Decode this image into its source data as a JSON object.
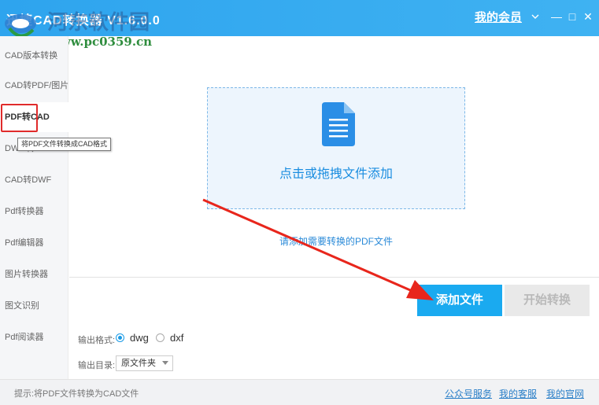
{
  "app": {
    "title": "迅捷CAD转换器 V1.6.0.0",
    "member_link": "我的会员",
    "watermark": "河东软件园",
    "watermark_url": "www.pc0359.cn"
  },
  "window_controls": {
    "dropdown_icon": "chevron-down-icon",
    "minimize": "—",
    "maximize": "□",
    "close": "✕"
  },
  "sidebar": {
    "items": [
      {
        "label": "CAD版本转换"
      },
      {
        "label": "CAD转PDF/图片"
      },
      {
        "label": "PDF转CAD",
        "active": true
      },
      {
        "label": "DWG转DWF"
      },
      {
        "label": "CAD转DWF"
      },
      {
        "label": "Pdf转换器"
      },
      {
        "label": "Pdf编辑器"
      },
      {
        "label": "图片转换器"
      },
      {
        "label": "图文识别"
      },
      {
        "label": "Pdf阅读器"
      }
    ],
    "tooltip": "将PDF文件转换成CAD格式"
  },
  "main": {
    "dropzone_icon": "document-icon",
    "dropzone_text": "点击或拖拽文件添加",
    "hint": "请添加需要转换的PDF文件",
    "add_button": "添加文件",
    "start_button": "开始转换"
  },
  "options": {
    "format_label": "输出格式:",
    "formats": [
      {
        "label": "dwg",
        "checked": true
      },
      {
        "label": "dxf",
        "checked": false
      }
    ],
    "dir_label": "输出目录:",
    "dir_value": "原文件夹"
  },
  "statusbar": {
    "text": "提示:将PDF文件转换为CAD文件",
    "links": [
      "公众号服务",
      "我的客服",
      "我的官网"
    ]
  },
  "colors": {
    "titlebar": "#2ea4ee",
    "accent": "#1aaaf0",
    "highlight_box": "#e02b2b",
    "annotation_arrow": "#e8261c"
  }
}
